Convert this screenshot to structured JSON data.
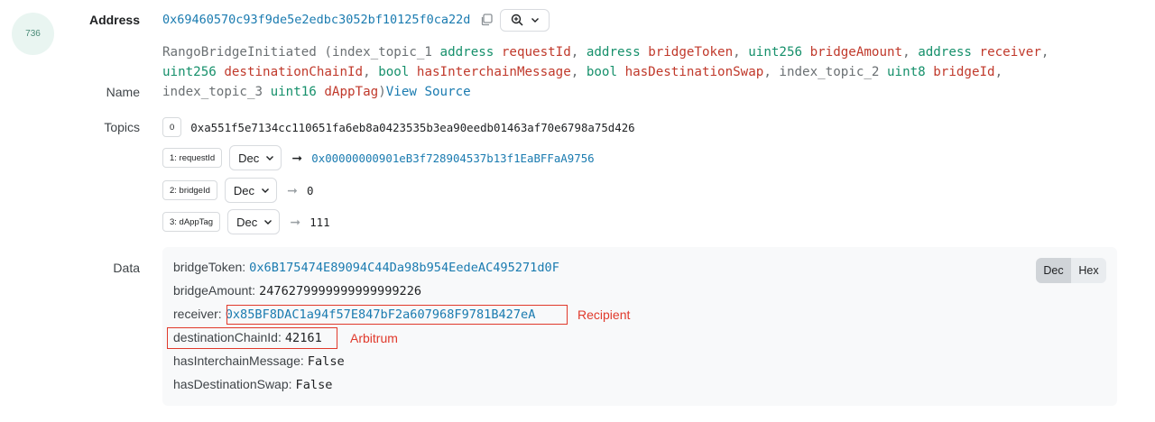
{
  "log_index": "736",
  "labels": {
    "address": "Address",
    "name": "Name",
    "topics": "Topics",
    "data": "Data"
  },
  "address": {
    "value": "0x69460570c93f9de5e2edbc3052bf10125f0ca22d",
    "copy_icon": "copy-icon",
    "zoom_icon": "zoom-in-icon"
  },
  "name": {
    "event": "RangoBridgeInitiated",
    "params": [
      {
        "prefix": "index_topic_1 ",
        "type": "address",
        "name": "requestId",
        "sep": ", "
      },
      {
        "prefix": "",
        "type": "address",
        "name": "bridgeToken",
        "sep": ", "
      },
      {
        "prefix": "",
        "type": "uint256",
        "name": "bridgeAmount",
        "sep": ", "
      },
      {
        "prefix": "",
        "type": "address",
        "name": "receiver",
        "sep": ","
      },
      {
        "prefix": "",
        "type": "uint256",
        "name": "destinationChainId",
        "sep": ", "
      },
      {
        "prefix": "",
        "type": "bool",
        "name": "hasInterchainMessage",
        "sep": ", "
      },
      {
        "prefix": "",
        "type": "bool",
        "name": "hasDestinationSwap",
        "sep": ", "
      },
      {
        "prefix": "index_topic_2 ",
        "type": "uint8",
        "name": "bridgeId",
        "sep": ","
      },
      {
        "prefix": "index_topic_3 ",
        "type": "uint16",
        "name": "dAppTag",
        "sep": ""
      }
    ],
    "view_source": "View Source"
  },
  "topics": [
    {
      "badge": "0",
      "value": "0xa551f5e7134cc110651fa6eb8a0423535b3ea90eedb01463af70e6798a75d426"
    },
    {
      "badge": "1: requestId",
      "format": "Dec",
      "value": "0x00000000901eB3f728904537b13f1EaBFFaA9756"
    },
    {
      "badge": "2: bridgeId",
      "format": "Dec",
      "value": "0"
    },
    {
      "badge": "3: dAppTag",
      "format": "Dec",
      "value": "111"
    }
  ],
  "data": {
    "rows": [
      {
        "key": "bridgeToken",
        "value": "0x6B175474E89094C44Da98b954EedeAC495271d0F"
      },
      {
        "key": "bridgeAmount",
        "value": "2476279999999999999226"
      },
      {
        "key": "receiver",
        "value": "0x85BF8DAC1a94f57E847bF2a607968F9781B427eA"
      },
      {
        "key": "destinationChainId",
        "value": "42161"
      },
      {
        "key": "hasInterchainMessage",
        "value": "False"
      },
      {
        "key": "hasDestinationSwap",
        "value": "False"
      }
    ],
    "separator": " : ",
    "toggle": {
      "dec": "Dec",
      "hex": "Hex",
      "selected": "Dec"
    },
    "annotations": {
      "receiver": "Recipient",
      "chain": "Arbitrum"
    },
    "annotation_color": "#e0392b"
  }
}
